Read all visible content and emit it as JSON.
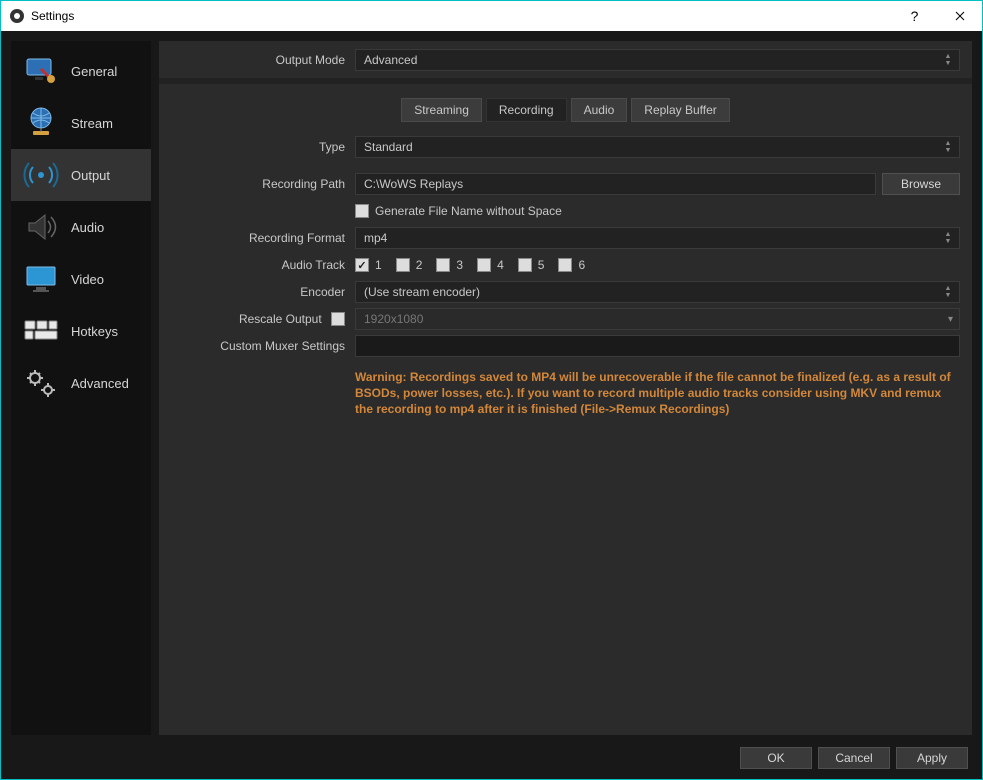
{
  "title": "Settings",
  "sidebar": {
    "items": [
      {
        "label": "General"
      },
      {
        "label": "Stream"
      },
      {
        "label": "Output"
      },
      {
        "label": "Audio"
      },
      {
        "label": "Video"
      },
      {
        "label": "Hotkeys"
      },
      {
        "label": "Advanced"
      }
    ],
    "active_index": 2
  },
  "output_mode": {
    "label": "Output Mode",
    "value": "Advanced"
  },
  "tabs": {
    "items": [
      "Streaming",
      "Recording",
      "Audio",
      "Replay Buffer"
    ],
    "active_index": 1
  },
  "fields": {
    "type": {
      "label": "Type",
      "value": "Standard"
    },
    "recording_path": {
      "label": "Recording Path",
      "value": "C:\\WoWS Replays",
      "browse": "Browse"
    },
    "gen_filename": {
      "label": "Generate File Name without Space",
      "checked": false
    },
    "recording_format": {
      "label": "Recording Format",
      "value": "mp4"
    },
    "audio_track": {
      "label": "Audio Track",
      "tracks": [
        {
          "n": "1",
          "on": true
        },
        {
          "n": "2",
          "on": false
        },
        {
          "n": "3",
          "on": false
        },
        {
          "n": "4",
          "on": false
        },
        {
          "n": "5",
          "on": false
        },
        {
          "n": "6",
          "on": false
        }
      ]
    },
    "encoder": {
      "label": "Encoder",
      "value": "(Use stream encoder)"
    },
    "rescale": {
      "label": "Rescale Output",
      "checked": false,
      "value": "1920x1080"
    },
    "muxer": {
      "label": "Custom Muxer Settings",
      "value": ""
    }
  },
  "warning": "Warning: Recordings saved to MP4 will be unrecoverable if the file cannot be finalized (e.g. as a result of BSODs, power losses, etc.). If you want to record multiple audio tracks consider using MKV and remux the recording to mp4 after it is finished (File->Remux Recordings)",
  "footer": {
    "ok": "OK",
    "cancel": "Cancel",
    "apply": "Apply"
  }
}
